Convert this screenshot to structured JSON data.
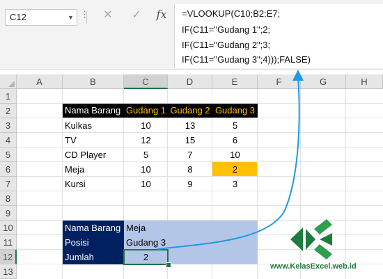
{
  "formula_bar": {
    "name_box": "C12",
    "cancel_icon": "✕",
    "enter_icon": "✓",
    "fx_label": "fx",
    "formula_lines": [
      "=VLOOKUP(C10;B2:E7;",
      "IF(C11=\"Gudang 1\";2;",
      "IF(C11=\"Gudang 2\";3;",
      "IF(C11=\"Gudang 3\";4)));FALSE)"
    ]
  },
  "columns": [
    "A",
    "B",
    "C",
    "D",
    "E",
    "F",
    "G",
    "H"
  ],
  "rows": [
    "1",
    "2",
    "3",
    "4",
    "5",
    "6",
    "7",
    "8",
    "9",
    "10",
    "11",
    "12",
    "13"
  ],
  "table": {
    "header": [
      "Nama Barang",
      "Gudang 1",
      "Gudang 2",
      "Gudang 3"
    ],
    "rows": [
      [
        "Kulkas",
        "10",
        "13",
        "5"
      ],
      [
        "TV",
        "12",
        "15",
        "6"
      ],
      [
        "CD Player",
        "5",
        "7",
        "10"
      ],
      [
        "Meja",
        "10",
        "8",
        "2"
      ],
      [
        "Kursi",
        "10",
        "9",
        "3"
      ]
    ]
  },
  "lookup": {
    "labels": [
      "Nama Barang",
      "Posisi",
      "Jumlah"
    ],
    "values": [
      "Meja",
      "Gudang 3",
      "2"
    ]
  },
  "colors": {
    "header_bg": "#000000",
    "header_text": "#ffffff",
    "header_gudang_text": "#ffc000",
    "highlight_cell": "#ffc000",
    "lookup_label_bg": "#002060",
    "lookup_value_bg": "#b4c6e7",
    "selection": "#217346",
    "arrow": "#1e9be2",
    "logo_green": "#1f7b3d"
  },
  "logo": {
    "text": "www.KelasExcel.web.id",
    "icon": "kelasexcel-k-logo-icon"
  }
}
